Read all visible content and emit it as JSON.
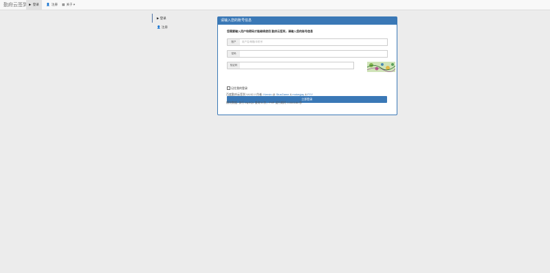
{
  "navbar": {
    "brand": "勤府云签到",
    "items": [
      {
        "icon": "play-icon",
        "glyph": "▶",
        "label": "登录"
      },
      {
        "icon": "user-icon",
        "glyph": "👤",
        "label": "注册"
      },
      {
        "icon": "grid-icon",
        "glyph": "▦",
        "label": "关于 ▾"
      }
    ]
  },
  "sidenav": {
    "items": [
      {
        "icon": "play-icon",
        "glyph": "▶",
        "label": "登录"
      },
      {
        "icon": "user-icon",
        "glyph": "👤",
        "label": "注册"
      }
    ]
  },
  "panel": {
    "title": "请输入您的账号信息",
    "notice": "您需要输入用户和密码才能继续使用 勤府云签到，请输入您的账号信息",
    "fields": {
      "username": {
        "label": "账户",
        "placeholder": "用户名/邮箱/手机号"
      },
      "password": {
        "label": "密码",
        "placeholder": ""
      },
      "captcha": {
        "label": "验证码",
        "placeholder": ""
      }
    },
    "remember": "记住我的登录",
    "submit": "立即登录"
  },
  "footer": {
    "line1_prefix": "百度勤府云签到 V4.92 // 作者:",
    "author1": "Kenvix",
    "at": "@",
    "author2": "StusGame",
    "amp1": "&",
    "author3": "mokeyjay",
    "amp2": "&",
    "author4": "FYY",
    "line2": "模块数据: 执行 MySQL 查询 8 次，PHP 运行耗时 0.000184 秒"
  },
  "colors": {
    "primary": "#3a78b6",
    "background": "#ececec"
  }
}
